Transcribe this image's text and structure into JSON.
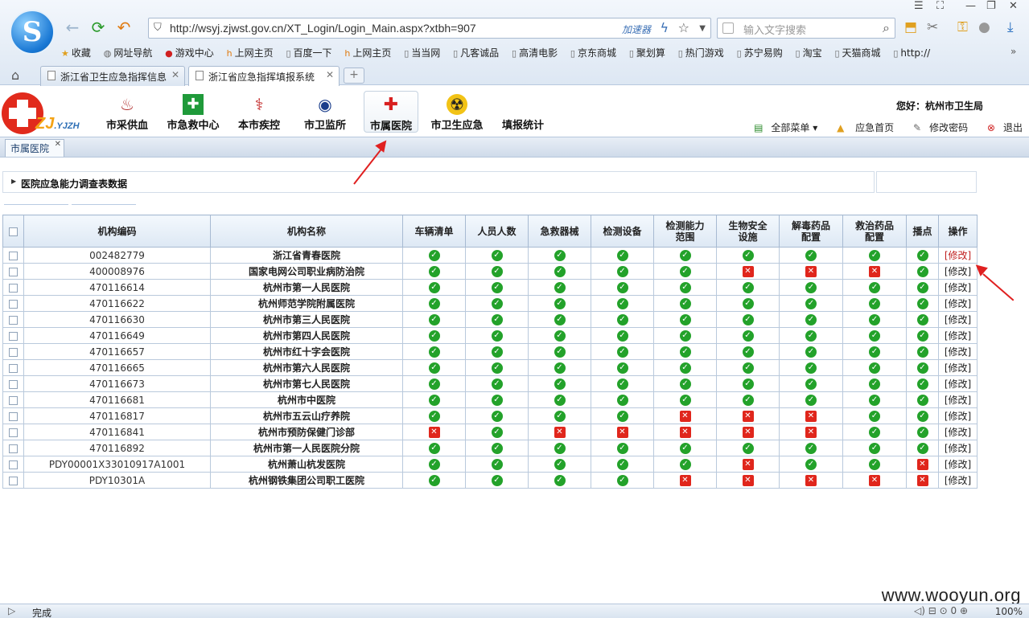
{
  "browser": {
    "url": "http://wsyj.zjwst.gov.cn/XT_Login/Login_Main.aspx?xtbh=907",
    "accelerator": "加速器",
    "search_placeholder": "输入文字搜索",
    "favorites": [
      {
        "label": "收藏"
      },
      {
        "label": "网址导航"
      },
      {
        "label": "游戏中心"
      },
      {
        "label": "上网主页"
      },
      {
        "label": "百度一下"
      },
      {
        "label": "上网主页"
      },
      {
        "label": "当当网"
      },
      {
        "label": "凡客诚品"
      },
      {
        "label": "高清电影"
      },
      {
        "label": "京东商城"
      },
      {
        "label": "聚划算"
      },
      {
        "label": "热门游戏"
      },
      {
        "label": "苏宁易购"
      },
      {
        "label": "淘宝"
      },
      {
        "label": "天猫商城"
      },
      {
        "label": "http://"
      }
    ],
    "tabs": [
      {
        "label": "浙江省卫生应急指挥信息"
      },
      {
        "label": "浙江省应急指挥填报系统"
      }
    ],
    "status": "完成",
    "zoom": "100%",
    "counter": "0"
  },
  "app": {
    "brand": "ZJ",
    "brand_sub": ".YJZH",
    "modules": [
      {
        "label": "市采供血"
      },
      {
        "label": "市急救中心"
      },
      {
        "label": "本市疾控"
      },
      {
        "label": "市卫监所"
      },
      {
        "label": "市属医院"
      },
      {
        "label": "市卫生应急"
      },
      {
        "label": "填报统计"
      }
    ],
    "greeting": "您好：杭州市卫生局",
    "links": {
      "menu": "全部菜单",
      "home": "应急首页",
      "password": "修改密码",
      "logout": "退出"
    },
    "subtab": "市属医院"
  },
  "section_title": "医院应急能力调查表数据",
  "table": {
    "headers": [
      "机构编码",
      "机构名称",
      "车辆清单",
      "人员人数",
      "急救器械",
      "检测设备",
      "检测能力范围",
      "生物安全设施",
      "解毒药品配置",
      "救治药品配置",
      "播点",
      "操作"
    ],
    "edit_label": "[修改]",
    "rows": [
      {
        "code": "002482779",
        "name": "浙江省青春医院",
        "flags": [
          1,
          1,
          1,
          1,
          1,
          1,
          1,
          1,
          1
        ]
      },
      {
        "code": "400008976",
        "name": "国家电网公司职业病防治院",
        "flags": [
          1,
          1,
          1,
          1,
          1,
          0,
          0,
          0,
          1
        ]
      },
      {
        "code": "470116614",
        "name": "杭州市第一人民医院",
        "flags": [
          1,
          1,
          1,
          1,
          1,
          1,
          1,
          1,
          1
        ]
      },
      {
        "code": "470116622",
        "name": "杭州师范学院附属医院",
        "flags": [
          1,
          1,
          1,
          1,
          1,
          1,
          1,
          1,
          1
        ]
      },
      {
        "code": "470116630",
        "name": "杭州市第三人民医院",
        "flags": [
          1,
          1,
          1,
          1,
          1,
          1,
          1,
          1,
          1
        ]
      },
      {
        "code": "470116649",
        "name": "杭州市第四人民医院",
        "flags": [
          1,
          1,
          1,
          1,
          1,
          1,
          1,
          1,
          1
        ]
      },
      {
        "code": "470116657",
        "name": "杭州市红十字会医院",
        "flags": [
          1,
          1,
          1,
          1,
          1,
          1,
          1,
          1,
          1
        ]
      },
      {
        "code": "470116665",
        "name": "杭州市第六人民医院",
        "flags": [
          1,
          1,
          1,
          1,
          1,
          1,
          1,
          1,
          1
        ]
      },
      {
        "code": "470116673",
        "name": "杭州市第七人民医院",
        "flags": [
          1,
          1,
          1,
          1,
          1,
          1,
          1,
          1,
          1
        ]
      },
      {
        "code": "470116681",
        "name": "杭州市中医院",
        "flags": [
          1,
          1,
          1,
          1,
          1,
          1,
          1,
          1,
          1
        ]
      },
      {
        "code": "470116817",
        "name": "杭州市五云山疗养院",
        "flags": [
          1,
          1,
          1,
          1,
          0,
          0,
          0,
          1,
          1
        ]
      },
      {
        "code": "470116841",
        "name": "杭州市预防保健门诊部",
        "flags": [
          0,
          1,
          0,
          0,
          0,
          0,
          0,
          1,
          1
        ]
      },
      {
        "code": "470116892",
        "name": "杭州市第一人民医院分院",
        "flags": [
          1,
          1,
          1,
          1,
          1,
          1,
          1,
          1,
          1
        ]
      },
      {
        "code": "PDY00001X33010917A1001",
        "name": "杭州萧山杭发医院",
        "flags": [
          1,
          1,
          1,
          1,
          1,
          0,
          1,
          1,
          0
        ]
      },
      {
        "code": "PDY10301A",
        "name": "杭州钢铁集团公司职工医院",
        "flags": [
          1,
          1,
          1,
          1,
          0,
          0,
          0,
          0,
          0
        ]
      }
    ]
  },
  "watermark": "www.wooyun.org"
}
